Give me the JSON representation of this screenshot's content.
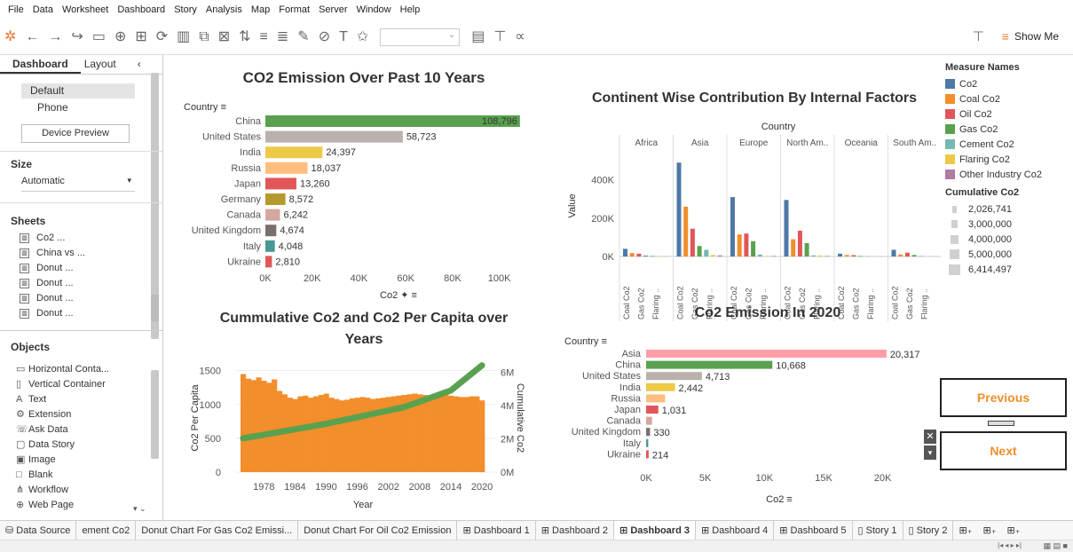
{
  "menu": [
    "File",
    "Data",
    "Worksheet",
    "Dashboard",
    "Story",
    "Analysis",
    "Map",
    "Format",
    "Server",
    "Window",
    "Help"
  ],
  "toolbar": {
    "show_me": "Show Me"
  },
  "left": {
    "tab_dashboard": "Dashboard",
    "tab_layout": "Layout",
    "devices": [
      "Default",
      "Phone"
    ],
    "device_preview": "Device Preview",
    "size_label": "Size",
    "size_value": "Automatic",
    "sheets_label": "Sheets",
    "sheets": [
      "Co2 ...",
      "China vs ...",
      "Donut ...",
      "Donut ...",
      "Donut ...",
      "Donut ..."
    ],
    "objects_label": "Objects",
    "objects": [
      "Horizontal Conta...",
      "Vertical Container",
      "Text",
      "Extension",
      "Ask Data",
      "Data Story",
      "Image",
      "Blank",
      "Workflow",
      "Web Page"
    ]
  },
  "charts": {
    "top_left": {
      "title": "CO2 Emission Over Past 10 Years",
      "axis_label": "Country",
      "footer": "Co2",
      "ticks": [
        "0K",
        "20K",
        "40K",
        "60K",
        "80K",
        "100K"
      ]
    },
    "top_right": {
      "title": "Continent Wise Contribution By Internal Factors",
      "header": "Country",
      "ylabel": "Value",
      "yticks": [
        "400K",
        "200K",
        "0K"
      ],
      "continents": [
        "Africa",
        "Asia",
        "Europe",
        "North Am..",
        "Oceania",
        "South Am.."
      ],
      "xlabels": [
        "Coal Co2",
        "Gas Co2",
        "Flaring .."
      ]
    },
    "bottom_left": {
      "title_line1": "Cummulative Co2 and Co2 Per Capita over",
      "title_line2": "Years",
      "ylabel_left": "Co2 Per Capita",
      "ylabel_right": "Cumulative Co2",
      "xlabel": "Year",
      "yticks_left": [
        "1500",
        "1000",
        "500",
        "0"
      ],
      "yticks_right": [
        "6M",
        "4M",
        "2M",
        "0M"
      ],
      "xticks": [
        "1978",
        "1984",
        "1990",
        "1996",
        "2002",
        "2008",
        "2014",
        "2020"
      ]
    },
    "bottom_right": {
      "title": "Co2 Emission In 2020",
      "axis_label": "Country",
      "footer": "Co2",
      "ticks": [
        "0K",
        "5K",
        "10K",
        "15K",
        "20K"
      ]
    }
  },
  "legend": {
    "title": "Measure Names",
    "items": [
      {
        "label": "Co2",
        "color": "#4e79a7"
      },
      {
        "label": "Coal Co2",
        "color": "#f28e2b"
      },
      {
        "label": "Oil Co2",
        "color": "#e15759"
      },
      {
        "label": "Gas Co2",
        "color": "#59a14f"
      },
      {
        "label": "Cement Co2",
        "color": "#76b7b2"
      },
      {
        "label": "Flaring Co2",
        "color": "#edc948"
      },
      {
        "label": "Other Industry Co2",
        "color": "#b07aa1"
      }
    ],
    "size_title": "Cumulative Co2",
    "sizes": [
      "2,026,741",
      "3,000,000",
      "4,000,000",
      "5,000,000",
      "6,414,497"
    ]
  },
  "buttons": {
    "previous": "Previous",
    "next": "Next"
  },
  "bottom_tabs": [
    "Data Source",
    "ement Co2",
    "Donut Chart For Gas Co2 Emissi...",
    "Donut Chart For Oil Co2 Emission",
    "Dashboard 1",
    "Dashboard 2",
    "Dashboard 3",
    "Dashboard 4",
    "Dashboard 5",
    "Story 1",
    "Story 2"
  ],
  "chart_data": [
    {
      "type": "bar",
      "title": "CO2 Emission Over Past 10 Years",
      "categories": [
        "China",
        "United States",
        "India",
        "Russia",
        "Japan",
        "Germany",
        "Canada",
        "United Kingdom",
        "Italy",
        "Ukraine"
      ],
      "values": [
        108796,
        58723,
        24397,
        18037,
        13260,
        8572,
        6242,
        4674,
        4048,
        2810
      ],
      "colors": [
        "#59a14f",
        "#bab0ac",
        "#edc948",
        "#ffbe7d",
        "#e15759",
        "#b6992d",
        "#d4a6a0",
        "#79706e",
        "#499894",
        "#e15759"
      ],
      "xlabel": "Co2",
      "xlim": [
        0,
        110000
      ]
    },
    {
      "type": "bar",
      "title": "Continent Wise Contribution By Internal Factors",
      "ylabel": "Value",
      "ylim": [
        -60000,
        560000
      ],
      "continents": [
        "Africa",
        "Asia",
        "Europe",
        "North Am..",
        "Oceania",
        "South Am.."
      ],
      "series": [
        {
          "name": "Co2",
          "color": "#4e79a7",
          "values": [
            40000,
            490000,
            310000,
            295000,
            15000,
            35000
          ]
        },
        {
          "name": "Coal Co2",
          "color": "#f28e2b",
          "values": [
            18000,
            260000,
            115000,
            90000,
            8000,
            10000
          ]
        },
        {
          "name": "Oil Co2",
          "color": "#e15759",
          "values": [
            15000,
            145000,
            120000,
            135000,
            7000,
            20000
          ]
        },
        {
          "name": "Gas Co2",
          "color": "#59a14f",
          "values": [
            5000,
            55000,
            80000,
            70000,
            3000,
            8000
          ]
        },
        {
          "name": "Cement Co2",
          "color": "#76b7b2",
          "values": [
            4000,
            35000,
            10000,
            6000,
            2000,
            3000
          ]
        },
        {
          "name": "Flaring Co2",
          "color": "#edc948",
          "values": [
            3000,
            8000,
            3000,
            5000,
            1000,
            1000
          ]
        },
        {
          "name": "Other Industry Co2",
          "color": "#b07aa1",
          "values": [
            1000,
            6000,
            3000,
            3000,
            500,
            500
          ]
        }
      ]
    },
    {
      "type": "bar",
      "title": "Cummulative Co2 and Co2 Per Capita over Years",
      "xlabel": "Year",
      "ylabel": "Co2 Per Capita",
      "ylim": [
        0,
        1600
      ],
      "x_start": 1974,
      "x_end": 2020,
      "values": [
        1450,
        1380,
        1360,
        1400,
        1350,
        1320,
        1370,
        1200,
        1150,
        1100,
        1080,
        1120,
        1130,
        1100,
        1120,
        1140,
        1160,
        1100,
        1080,
        1060,
        1070,
        1090,
        1100,
        1110,
        1100,
        1080,
        1090,
        1100,
        1110,
        1120,
        1130,
        1140,
        1150,
        1160,
        1150,
        1140,
        1120,
        1150,
        1160,
        1150,
        1130,
        1120,
        1110,
        1110,
        1120,
        1120,
        1060
      ],
      "line": {
        "name": "Cumulative Co2",
        "ylim": [
          0,
          6500000
        ],
        "x": [
          1974,
          1990,
          2005,
          2014,
          2020
        ],
        "values": [
          2030000,
          2900000,
          3900000,
          4900000,
          6410000
        ]
      }
    },
    {
      "type": "bar",
      "title": "Co2 Emission In 2020",
      "categories": [
        "Asia",
        "China",
        "United States",
        "India",
        "Russia",
        "Japan",
        "Canada",
        "United Kingdom",
        "Italy",
        "Ukraine"
      ],
      "values": [
        20317,
        10668,
        4713,
        2442,
        1600,
        1031,
        500,
        330,
        180,
        214
      ],
      "labels": [
        "20,317",
        "10,668",
        "4,713",
        "2,442",
        "",
        "1,031",
        "",
        "330",
        "",
        "214"
      ],
      "colors": [
        "#ff9da7",
        "#59a14f",
        "#bab0ac",
        "#edc948",
        "#ffbe7d",
        "#e15759",
        "#d4a6a0",
        "#79706e",
        "#499894",
        "#e15759"
      ],
      "xlabel": "Co2",
      "xlim": [
        0,
        21000
      ]
    }
  ]
}
